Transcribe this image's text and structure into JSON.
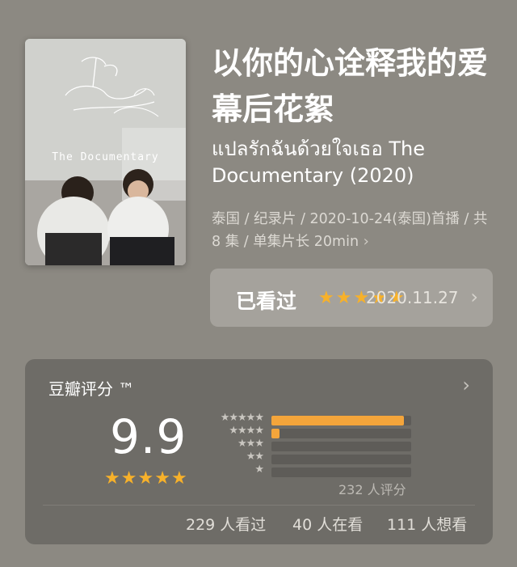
{
  "poster": {
    "script_title": "I told Sunset about You",
    "subtitle": "The Documentary"
  },
  "title": "以你的心诠释我的爱幕后花絮",
  "original_title": "แปลรักฉันด้วยใจเธอ The Documentary (2020)",
  "meta": {
    "text": "泰国 / 纪录片 / 2020-10-24(泰国)首播 / 共 8 集 / 单集片长 20min",
    "chevron": "›"
  },
  "watched": {
    "label": "已看过",
    "stars": 5,
    "date": "2020.11.27",
    "chevron": "›"
  },
  "rating": {
    "title": "豆瓣评分 ™",
    "chevron": "›",
    "score": "9.9",
    "score_stars": 5,
    "distribution": [
      {
        "stars": "★★★★★",
        "percent": 95
      },
      {
        "stars": "★★★★",
        "percent": 6
      },
      {
        "stars": "★★★",
        "percent": 0
      },
      {
        "stars": "★★",
        "percent": 0
      },
      {
        "stars": "★",
        "percent": 0
      }
    ],
    "total": "232 人评分",
    "stats": {
      "watched": "229 人看过",
      "watching": "40 人在看",
      "want": "111 人想看"
    }
  },
  "colors": {
    "accent_star": "#f7b12a",
    "bar_fill": "#f4a53b",
    "background": "#8c8982"
  }
}
